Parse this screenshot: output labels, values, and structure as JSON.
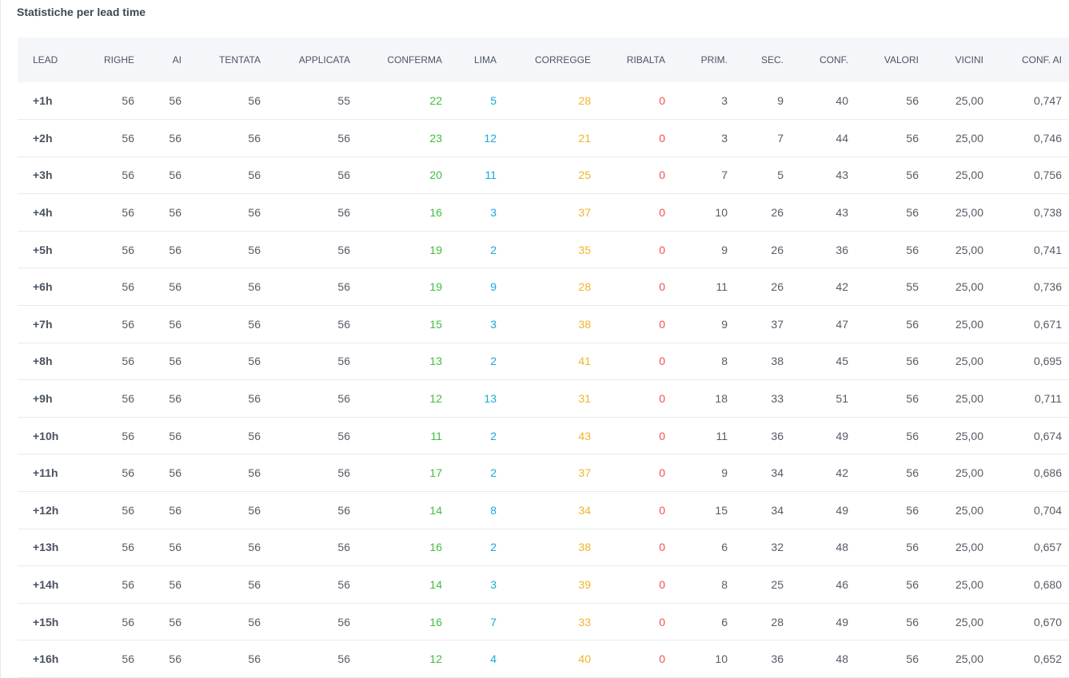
{
  "title": "Statistiche per lead time",
  "colors": {
    "conferma": "#3fbd3b",
    "lima": "#1aa7d8",
    "corregge": "#f0b42a",
    "ribalta": "#ef4f4f",
    "header_bg": "#f4f6fa"
  },
  "columns": [
    "LEAD",
    "RIGHE",
    "AI",
    "TENTATA",
    "APPLICATA",
    "CONFERMA",
    "LIMA",
    "CORREGGE",
    "RIBALTA",
    "PRIM.",
    "SEC.",
    "CONF.",
    "VALORI",
    "VICINI",
    "CONF. AI"
  ],
  "rows": [
    [
      "+1h",
      "56",
      "56",
      "56",
      "55",
      "22",
      "5",
      "28",
      "0",
      "3",
      "9",
      "40",
      "56",
      "25,00",
      "0,747"
    ],
    [
      "+2h",
      "56",
      "56",
      "56",
      "56",
      "23",
      "12",
      "21",
      "0",
      "3",
      "7",
      "44",
      "56",
      "25,00",
      "0,746"
    ],
    [
      "+3h",
      "56",
      "56",
      "56",
      "56",
      "20",
      "11",
      "25",
      "0",
      "7",
      "5",
      "43",
      "56",
      "25,00",
      "0,756"
    ],
    [
      "+4h",
      "56",
      "56",
      "56",
      "56",
      "16",
      "3",
      "37",
      "0",
      "10",
      "26",
      "43",
      "56",
      "25,00",
      "0,738"
    ],
    [
      "+5h",
      "56",
      "56",
      "56",
      "56",
      "19",
      "2",
      "35",
      "0",
      "9",
      "26",
      "36",
      "56",
      "25,00",
      "0,741"
    ],
    [
      "+6h",
      "56",
      "56",
      "56",
      "56",
      "19",
      "9",
      "28",
      "0",
      "11",
      "26",
      "42",
      "55",
      "25,00",
      "0,736"
    ],
    [
      "+7h",
      "56",
      "56",
      "56",
      "56",
      "15",
      "3",
      "38",
      "0",
      "9",
      "37",
      "47",
      "56",
      "25,00",
      "0,671"
    ],
    [
      "+8h",
      "56",
      "56",
      "56",
      "56",
      "13",
      "2",
      "41",
      "0",
      "8",
      "38",
      "45",
      "56",
      "25,00",
      "0,695"
    ],
    [
      "+9h",
      "56",
      "56",
      "56",
      "56",
      "12",
      "13",
      "31",
      "0",
      "18",
      "33",
      "51",
      "56",
      "25,00",
      "0,711"
    ],
    [
      "+10h",
      "56",
      "56",
      "56",
      "56",
      "11",
      "2",
      "43",
      "0",
      "11",
      "36",
      "49",
      "56",
      "25,00",
      "0,674"
    ],
    [
      "+11h",
      "56",
      "56",
      "56",
      "56",
      "17",
      "2",
      "37",
      "0",
      "9",
      "34",
      "42",
      "56",
      "25,00",
      "0,686"
    ],
    [
      "+12h",
      "56",
      "56",
      "56",
      "56",
      "14",
      "8",
      "34",
      "0",
      "15",
      "34",
      "49",
      "56",
      "25,00",
      "0,704"
    ],
    [
      "+13h",
      "56",
      "56",
      "56",
      "56",
      "16",
      "2",
      "38",
      "0",
      "6",
      "32",
      "48",
      "56",
      "25,00",
      "0,657"
    ],
    [
      "+14h",
      "56",
      "56",
      "56",
      "56",
      "14",
      "3",
      "39",
      "0",
      "8",
      "25",
      "46",
      "56",
      "25,00",
      "0,680"
    ],
    [
      "+15h",
      "56",
      "56",
      "56",
      "56",
      "16",
      "7",
      "33",
      "0",
      "6",
      "28",
      "49",
      "56",
      "25,00",
      "0,670"
    ],
    [
      "+16h",
      "56",
      "56",
      "56",
      "56",
      "12",
      "4",
      "40",
      "0",
      "10",
      "36",
      "48",
      "56",
      "25,00",
      "0,652"
    ]
  ]
}
